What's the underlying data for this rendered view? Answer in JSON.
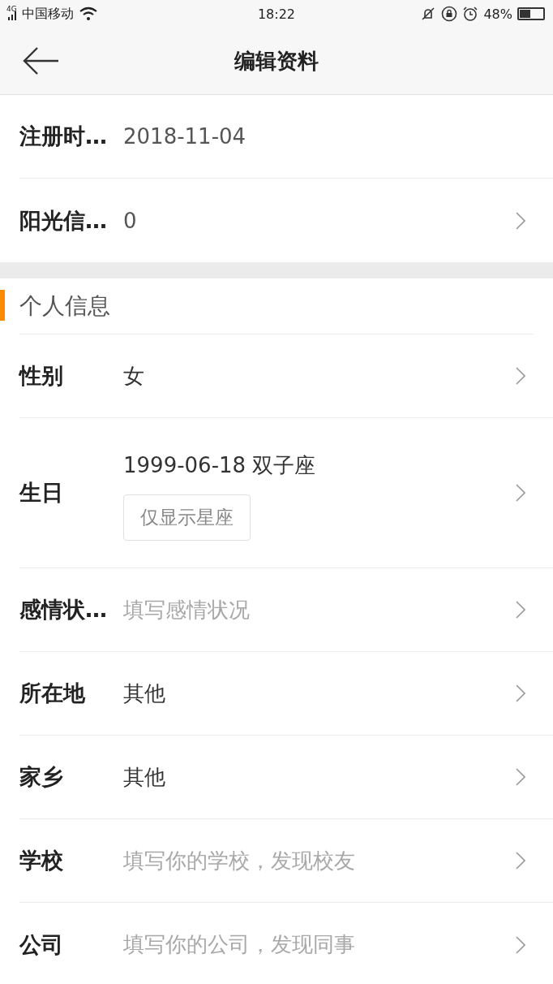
{
  "status_bar": {
    "network": "4G",
    "carrier": "中国移动",
    "time": "18:22",
    "battery_text": "48%"
  },
  "header": {
    "title": "编辑资料"
  },
  "account_rows": [
    {
      "label": "注册时…",
      "value": "2018-11-04",
      "chevron": false
    },
    {
      "label": "阳光信…",
      "value": "0",
      "chevron": true
    }
  ],
  "section": {
    "title": "个人信息"
  },
  "profile_rows": [
    {
      "kind": "plain",
      "label": "性别",
      "value": "女",
      "chevron": true
    },
    {
      "kind": "birthday",
      "label": "生日",
      "value": "1999-06-18 双子座",
      "option": "仅显示星座",
      "chevron": true
    },
    {
      "kind": "plain",
      "label": "感情状…",
      "placeholder": "填写感情状况",
      "chevron": true
    },
    {
      "kind": "plain",
      "label": "所在地",
      "value": "其他",
      "chevron": true
    },
    {
      "kind": "plain",
      "label": "家乡",
      "value": "其他",
      "chevron": true
    },
    {
      "kind": "plain",
      "label": "学校",
      "placeholder": "填写你的学校，发现校友",
      "chevron": true
    },
    {
      "kind": "plain",
      "label": "公司",
      "placeholder": "填写你的公司，发现同事",
      "chevron": true
    }
  ]
}
